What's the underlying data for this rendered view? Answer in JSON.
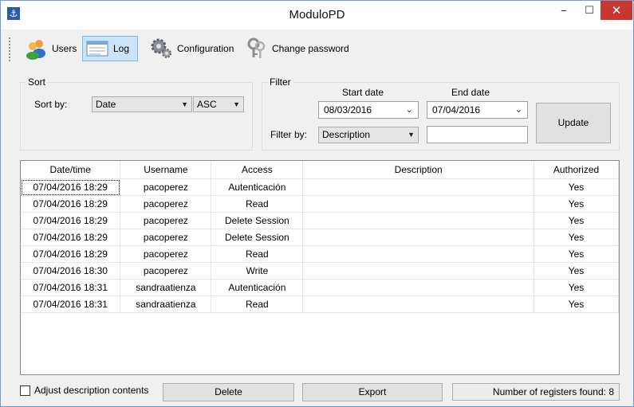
{
  "window": {
    "title": "ModuloPD",
    "minimize": "–",
    "maximize": "☐",
    "close": "✕"
  },
  "toolbar": {
    "users": "Users",
    "log": "Log",
    "configuration": "Configuration",
    "change_password": "Change password"
  },
  "sort": {
    "title": "Sort",
    "sort_by_label": "Sort by:",
    "field_value": "Date",
    "order_value": "ASC"
  },
  "filter": {
    "title": "Filter",
    "start_date_label": "Start date",
    "end_date_label": "End date",
    "start_date": "08/03/2016",
    "end_date": "07/04/2016",
    "filter_by_label": "Filter by:",
    "filter_field": "Description",
    "filter_text": "",
    "update_label": "Update"
  },
  "table": {
    "columns": [
      "Date/time",
      "Username",
      "Access",
      "Description",
      "Authorized"
    ],
    "rows": [
      [
        "07/04/2016 18:29",
        "pacoperez",
        "Autenticación",
        "",
        "Yes"
      ],
      [
        "07/04/2016 18:29",
        "pacoperez",
        "Read",
        "",
        "Yes"
      ],
      [
        "07/04/2016 18:29",
        "pacoperez",
        "Delete Session",
        "",
        "Yes"
      ],
      [
        "07/04/2016 18:29",
        "pacoperez",
        "Delete Session",
        "",
        "Yes"
      ],
      [
        "07/04/2016 18:29",
        "pacoperez",
        "Read",
        "",
        "Yes"
      ],
      [
        "07/04/2016 18:30",
        "pacoperez",
        "Write",
        "",
        "Yes"
      ],
      [
        "07/04/2016 18:31",
        "sandraatienza",
        "Autenticación",
        "",
        "Yes"
      ],
      [
        "07/04/2016 18:31",
        "sandraatienza",
        "Read",
        "",
        "Yes"
      ]
    ]
  },
  "footer": {
    "adjust_label": "Adjust description contents",
    "delete_label": "Delete",
    "export_label": "Export",
    "status_text": "Number of registers found: 8"
  }
}
